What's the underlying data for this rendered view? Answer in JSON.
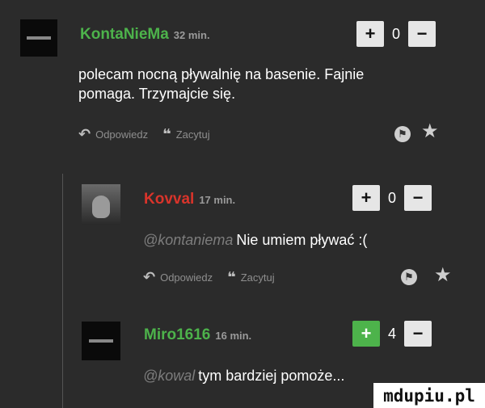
{
  "colors": {
    "background": "#2b2b2b",
    "author_green": "#4db34b",
    "author_red": "#d9342b"
  },
  "comments": [
    {
      "author": "KontaNieMa",
      "time": "32 min.",
      "score": "0",
      "text_lines": [
        "polecam nocną pływalnię na basenie. Fajnie",
        "pomaga. Trzymajcie się."
      ],
      "reply_label": "Odpowiedz",
      "quote_label": "Zacytuj",
      "author_color": "#4db34b"
    },
    {
      "author": "Kovval",
      "time": "17 min.",
      "score": "0",
      "mention": "@kontaniema",
      "text": "Nie umiem pływać :(",
      "reply_label": "Odpowiedz",
      "quote_label": "Zacytuj",
      "author_color": "#d9342b"
    },
    {
      "author": "Miro1616",
      "time": "16 min.",
      "score": "4",
      "mention": "@kowal",
      "text": "tym bardziej pomoże...",
      "author_color": "#4db34b"
    }
  ],
  "vote_plus": "+",
  "vote_minus": "−",
  "icons": {
    "reply": "reply-arrow-icon",
    "quote": "quote-icon",
    "flag": "flag-icon",
    "star": "star-icon"
  },
  "watermark": "mdupiu.pl"
}
